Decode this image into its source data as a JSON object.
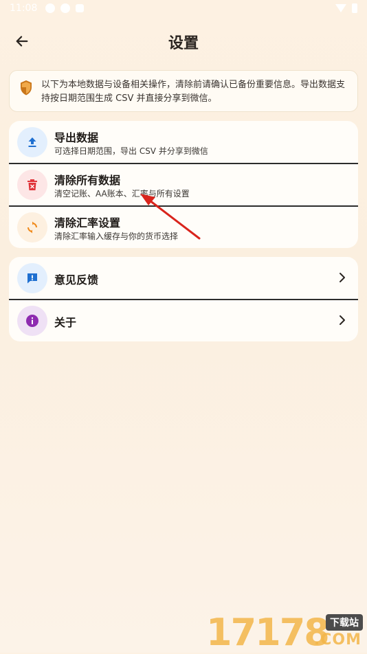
{
  "status_bar": {
    "time": "11:08"
  },
  "header": {
    "title": "设置"
  },
  "notice": {
    "text": "以下为本地数据与设备相关操作，清除前请确认已备份重要信息。导出数据支持按日期范围生成 CSV 并直接分享到微信。"
  },
  "data_section": {
    "items": [
      {
        "title": "导出数据",
        "subtitle": "可选择日期范围，导出 CSV 并分享到微信",
        "icon": "upload-icon",
        "icon_color": "#1e6fd0",
        "icon_bg": "#e3effd"
      },
      {
        "title": "清除所有数据",
        "subtitle": "清空记账、AA账本、汇率与所有设置",
        "icon": "trash-icon",
        "icon_color": "#e0343a",
        "icon_bg": "#fde6e6"
      },
      {
        "title": "清除汇率设置",
        "subtitle": "清除汇率输入缓存与你的货币选择",
        "icon": "refresh-icon",
        "icon_color": "#f08a1c",
        "icon_bg": "#fdf0e0"
      }
    ]
  },
  "other_section": {
    "items": [
      {
        "title": "意见反馈",
        "icon": "feedback-icon",
        "icon_color": "#1e6fd0",
        "icon_bg": "#e3effd"
      },
      {
        "title": "关于",
        "icon": "info-icon",
        "icon_color": "#8e2bb0",
        "icon_bg": "#efe1f5"
      }
    ]
  },
  "colors": {
    "annotation_arrow": "#d9241c",
    "watermark": "#f3b64a"
  },
  "watermark": {
    "digits": "17178",
    "badge": "下载站",
    "domain": ".COM"
  }
}
